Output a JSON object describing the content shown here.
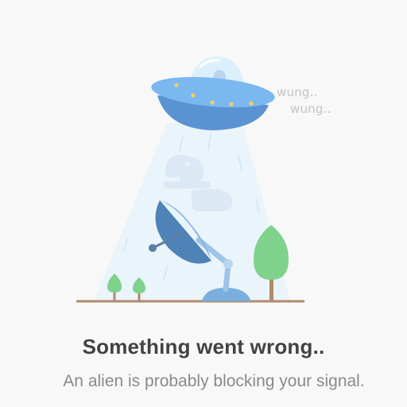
{
  "illustration": {
    "sound_1": "wung..",
    "sound_2": "wung..",
    "icons": [
      "ufo-icon",
      "satellite-dish-icon",
      "tree-icon"
    ]
  },
  "error": {
    "title": "Something went wrong..",
    "message": "An alien is probably blocking your signal."
  },
  "colors": {
    "background": "#f8f8f8",
    "title": "#424242",
    "message": "#8a8a8a",
    "ufo": "#6aa6e6",
    "tree": "#7fd28b",
    "ground": "#b08a6a"
  }
}
